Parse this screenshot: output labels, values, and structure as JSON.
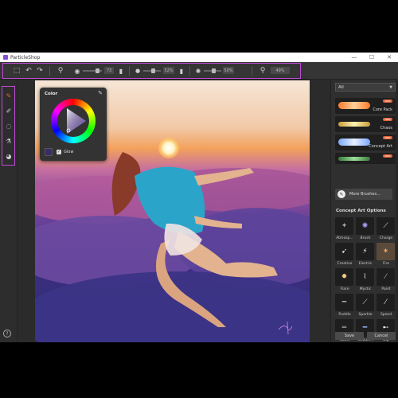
{
  "app": {
    "title": "ParticleShop",
    "accent": "#c04bd6"
  },
  "toolbar": {
    "size_value": "73",
    "opacity_value": "52%",
    "grain_value": "50%",
    "zoom_value": "49%"
  },
  "color_panel": {
    "title": "Color",
    "glow_label": "Glow",
    "glow_checked": "✓",
    "current_color": "#3c2a6a"
  },
  "brush_panel": {
    "category": "All",
    "brushes": [
      {
        "label": "Core Pack",
        "badge": "NEW"
      },
      {
        "label": "Chaos",
        "badge": "NEW"
      },
      {
        "label": "Concept Art",
        "badge": "NEW"
      },
      {
        "label": "",
        "badge": "NEW"
      }
    ],
    "more_label": "More Brushes..."
  },
  "options": {
    "title": "Concept Art Options",
    "items": [
      {
        "label": "Atmosp..."
      },
      {
        "label": "Brush"
      },
      {
        "label": "Charge"
      },
      {
        "label": "Creative"
      },
      {
        "label": "Electric"
      },
      {
        "label": "Fire"
      },
      {
        "label": "Flare"
      },
      {
        "label": "Mystic"
      },
      {
        "label": "Paint"
      },
      {
        "label": "Puddle"
      },
      {
        "label": "Sparkle"
      },
      {
        "label": "Speed"
      },
      {
        "label": "Static"
      },
      {
        "label": "Turbule..."
      },
      {
        "label": "Zip"
      }
    ]
  },
  "footer": {
    "save": "Save",
    "cancel": "Cancel"
  },
  "help_label": "?"
}
